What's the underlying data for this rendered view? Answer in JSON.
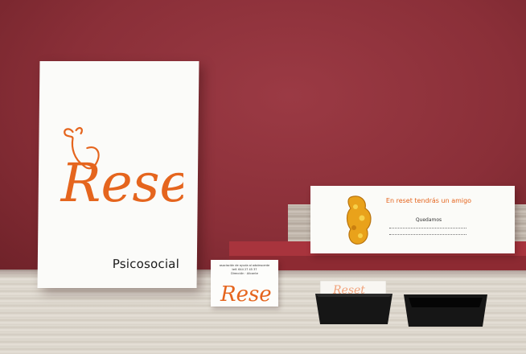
{
  "brand": {
    "name": "Reset",
    "tagline": "Psicosocial",
    "accent_color": "#e5651e"
  },
  "greeting_card": {
    "title": "En reset tendrás un amigo",
    "subtitle": "Quedamos"
  },
  "business_card": {
    "lines": [
      "asociación de ayuda al adolescente",
      "telf. 644 27 45 37",
      "Dirección · Alicante"
    ]
  },
  "card_holder": {
    "logo_text": "Reset"
  },
  "icons": [
    "butterfly-icon",
    "sponge-creature-icon"
  ]
}
